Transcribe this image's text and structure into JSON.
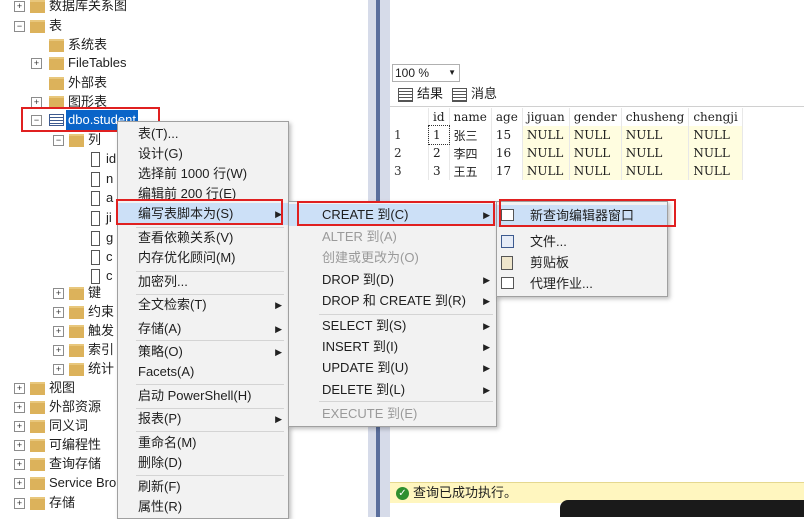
{
  "tree": {
    "top_items": [
      {
        "label": "数据库关系图"
      },
      {
        "label": "表"
      },
      {
        "label": "系统表"
      },
      {
        "label": "FileTables"
      },
      {
        "label": "外部表"
      },
      {
        "label": "图形表"
      }
    ],
    "selected_table": "dbo.student",
    "columns_folder": "列",
    "column_stubs": [
      "id",
      "n",
      "a",
      "ji",
      "g",
      "c",
      "c"
    ],
    "sub_folders": [
      "键",
      "约束",
      "触发",
      "索引",
      "统计"
    ],
    "bottom_items": [
      "视图",
      "外部资源",
      "同义词",
      "可编程性",
      "查询存储",
      "Service Bro",
      "存储"
    ]
  },
  "results": {
    "zoom": "100 %",
    "tab_results": "结果",
    "tab_messages": "消息",
    "headers": [
      "",
      "id",
      "name",
      "age",
      "jiguan",
      "gender",
      "chusheng",
      "chengji"
    ],
    "rows": [
      [
        "1",
        "1",
        "张三",
        "15",
        "NULL",
        "NULL",
        "NULL",
        "NULL"
      ],
      [
        "2",
        "2",
        "李四",
        "16",
        "NULL",
        "NULL",
        "NULL",
        "NULL"
      ],
      [
        "3",
        "3",
        "王五",
        "17",
        "NULL",
        "NULL",
        "NULL",
        "NULL"
      ]
    ],
    "status": "查询已成功执行。"
  },
  "menu1": {
    "items": [
      "表(T)...",
      "设计(G)",
      "选择前 1000 行(W)",
      "编辑前 200 行(E)",
      "编写表脚本为(S)",
      "查看依赖关系(V)",
      "内存优化顾问(M)",
      "加密列...",
      "全文检索(T)",
      "存储(A)",
      "策略(O)",
      "Facets(A)",
      "启动 PowerShell(H)",
      "报表(P)",
      "重命名(M)",
      "删除(D)",
      "刷新(F)",
      "属性(R)"
    ]
  },
  "menu2": {
    "items": [
      "CREATE 到(C)",
      "ALTER 到(A)",
      "创建或更改为(O)",
      "DROP 到(D)",
      "DROP 和 CREATE 到(R)",
      "SELECT 到(S)",
      "INSERT 到(I)",
      "UPDATE 到(U)",
      "DELETE 到(L)",
      "EXECUTE 到(E)"
    ]
  },
  "menu3": {
    "items": [
      "新查询编辑器窗口",
      "文件...",
      "剪贴板",
      "代理作业..."
    ]
  },
  "colors": {
    "highlight": "#cce0f7",
    "selection": "#0a64c8",
    "annotation": "#e02020",
    "null_cell": "#fffde0"
  }
}
